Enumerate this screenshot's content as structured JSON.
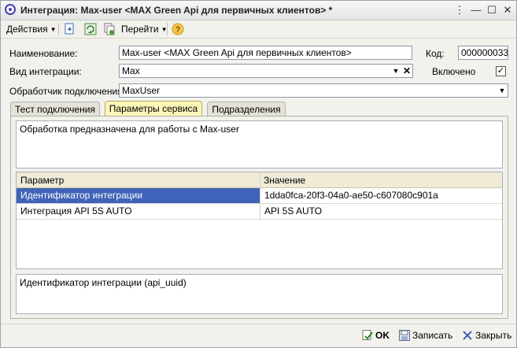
{
  "window": {
    "title": "Интеграция: Max-user <MAX Green Api для первичных клиентов> *"
  },
  "toolbar": {
    "actions_label": "Действия",
    "goto_label": "Перейти"
  },
  "form": {
    "name_label": "Наименование:",
    "name_value": "Max-user <MAX Green Api для первичных клиентов>",
    "code_label": "Код:",
    "code_value": "000000033",
    "type_label": "Вид интеграции:",
    "type_value": "Max",
    "enabled_label": "Включено",
    "enabled_checked": true,
    "handler_label": "Обработчик подключения:",
    "handler_value": "MaxUser"
  },
  "tabs": [
    {
      "label": "Тест подключения",
      "active": false
    },
    {
      "label": "Параметры сервиса",
      "active": true
    },
    {
      "label": "Подразделения",
      "active": false
    }
  ],
  "panel": {
    "description": "Обработка предназначена для работы с Max-user",
    "table": {
      "headers": [
        "Параметр",
        "Значение"
      ],
      "rows": [
        [
          "Идентификатор интеграции",
          "1dda0fca-20f3-04a0-ae50-c607080c901a"
        ],
        [
          "Интеграция API 5S AUTO",
          "API 5S AUTO"
        ]
      ],
      "selected_row": 0
    },
    "hint": "Идентификатор интеграции (api_uuid)"
  },
  "footer": {
    "ok_label": "OK",
    "save_label": "Записать",
    "close_label": "Закрыть"
  },
  "colors": {
    "active_tab": "#fbf5b8",
    "selection": "#3f63b8",
    "header_bg": "#efebd7"
  }
}
